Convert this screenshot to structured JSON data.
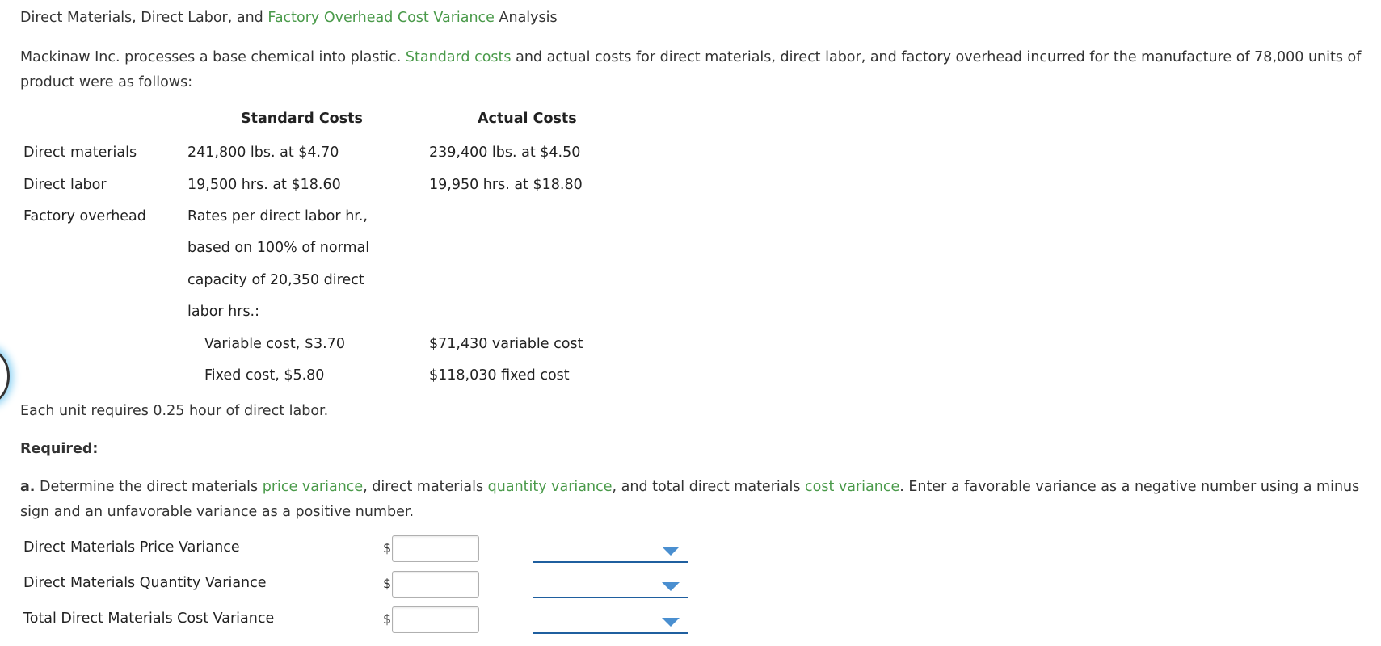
{
  "title": {
    "part1": "Direct Materials, Direct Labor, and ",
    "link": "Factory Overhead Cost Variance",
    "part2": " Analysis"
  },
  "intro": {
    "part1": "Mackinaw Inc. processes a base chemical into plastic. ",
    "link": "Standard costs",
    "part2": " and actual costs for direct materials, direct labor, and factory overhead incurred for the manufacture of 78,000 units of product were as follows:"
  },
  "table": {
    "headers": {
      "standard": "Standard Costs",
      "actual": "Actual Costs"
    },
    "rows": {
      "dm": {
        "label": "Direct materials",
        "standard": "241,800 lbs. at $4.70",
        "actual": "239,400 lbs. at $4.50"
      },
      "dl": {
        "label": "Direct labor",
        "standard": "19,500 hrs. at $18.60",
        "actual": "19,950 hrs. at $18.80"
      },
      "fo": {
        "label": "Factory overhead",
        "standard_lines": [
          "Rates per direct labor hr.,",
          "based on 100% of normal",
          "capacity of 20,350 direct",
          "labor hrs.:"
        ]
      },
      "var": {
        "standard": "Variable cost, $3.70",
        "actual": "$71,430 variable cost"
      },
      "fix": {
        "standard": "Fixed cost, $5.80",
        "actual": "$118,030 fixed cost"
      }
    }
  },
  "note": "Each unit requires 0.25 hour of direct labor.",
  "required": "Required:",
  "question": {
    "letter": "a.",
    "t1": " Determine the direct materials ",
    "l1": "price variance",
    "t2": ", direct materials ",
    "l2": "quantity variance",
    "t3": ", and total direct materials ",
    "l3": "cost variance",
    "t4": ". Enter a favorable variance as a negative number using a minus sign and an unfavorable variance as a positive number."
  },
  "answers": {
    "currency": "$",
    "rows": [
      {
        "label": "Direct Materials Price Variance",
        "value": "",
        "selected": ""
      },
      {
        "label": "Direct Materials Quantity Variance",
        "value": "",
        "selected": ""
      },
      {
        "label": "Total Direct Materials Cost Variance",
        "value": "",
        "selected": ""
      }
    ]
  },
  "colors": {
    "link_green": "#4a9a4a",
    "select_underline": "#1f5f9f",
    "arrow_blue": "#4a8fd0"
  }
}
